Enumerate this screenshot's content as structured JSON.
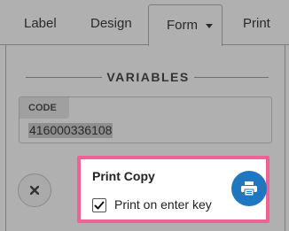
{
  "tabs": {
    "label": "Label",
    "design": "Design",
    "form": "Form",
    "print": "Print"
  },
  "variables": {
    "title": "VARIABLES",
    "field_label": "CODE",
    "field_value": "416000336108"
  },
  "popup": {
    "title": "Print Copy",
    "checkbox_label": "Print on enter key",
    "checkbox_checked": true
  },
  "colors": {
    "accent": "#1f77c2",
    "highlight_border": "#f06196"
  },
  "icons": {
    "form_tab": "chevron-down-icon",
    "close": "close-icon",
    "checkbox": "checkmark-icon",
    "print": "printer-icon"
  }
}
